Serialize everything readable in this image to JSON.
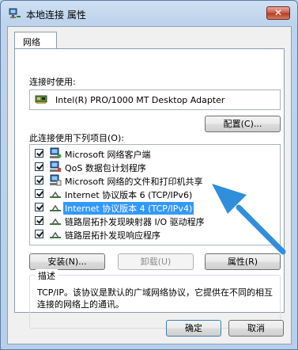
{
  "window": {
    "title": "本地连接 属性",
    "close_glyph": "✕"
  },
  "tabs": [
    {
      "label": "网络"
    }
  ],
  "connect_using_label": "连接时使用:",
  "adapter_name": "Intel(R) PRO/1000 MT Desktop Adapter",
  "configure_button": "配置(C)...",
  "items_label": "此连接使用下列项目(O):",
  "items": [
    {
      "label": "Microsoft 网络客户端",
      "checked": true,
      "icon": "network-client-icon"
    },
    {
      "label": "QoS 数据包计划程序",
      "checked": true,
      "icon": "qos-scheduler-icon"
    },
    {
      "label": "Microsoft 网络的文件和打印机共享",
      "checked": true,
      "icon": "file-printer-sharing-icon"
    },
    {
      "label": "Internet 协议版本 6 (TCP/IPv6)",
      "checked": true,
      "icon": "protocol-icon"
    },
    {
      "label": "Internet 协议版本 4 (TCP/IPv4)",
      "checked": true,
      "icon": "protocol-icon",
      "selected": true
    },
    {
      "label": "链路层拓扑发现映射器 I/O 驱动程序",
      "checked": true,
      "icon": "protocol-icon"
    },
    {
      "label": "链路层拓扑发现响应程序",
      "checked": true,
      "icon": "protocol-icon"
    }
  ],
  "buttons": {
    "install": "安装(N)...",
    "uninstall": "卸载(U)",
    "properties": "属性(R)"
  },
  "description": {
    "title": "描述",
    "text": "TCP/IP。该协议是默认的广域网络协议，它提供在不同的相互连接的网络上的通讯。"
  },
  "footer": {
    "ok": "确定",
    "cancel": "取消"
  },
  "colors": {
    "selection": "#3399ff",
    "arrow": "#2f8fdc"
  }
}
